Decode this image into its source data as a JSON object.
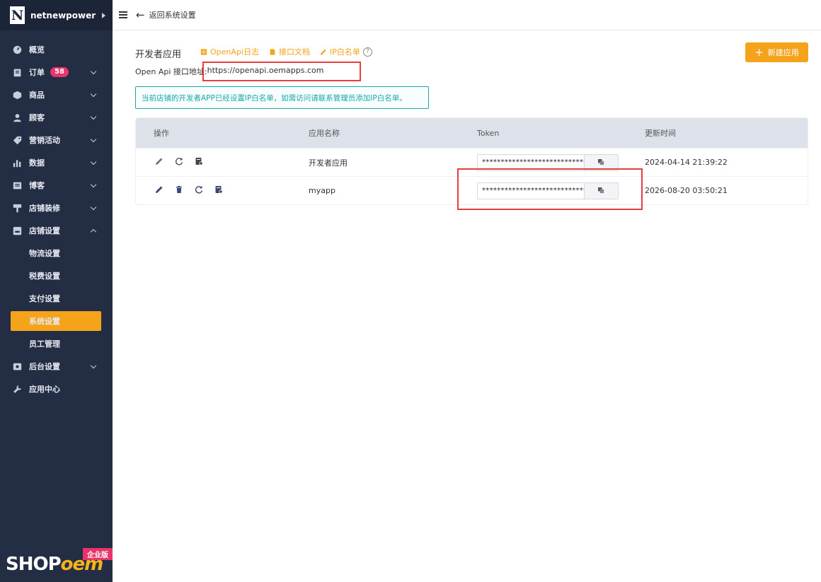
{
  "brand": {
    "logo_letter": "N",
    "name": "netnewpower"
  },
  "sidebar": {
    "items": [
      {
        "label": "概览",
        "icon": "dashboard-icon"
      },
      {
        "label": "订单",
        "icon": "order-icon",
        "badge": "58"
      },
      {
        "label": "商品",
        "icon": "product-icon"
      },
      {
        "label": "顾客",
        "icon": "customer-icon"
      },
      {
        "label": "营销活动",
        "icon": "tag-icon"
      },
      {
        "label": "数据",
        "icon": "chart-icon"
      },
      {
        "label": "博客",
        "icon": "blog-icon"
      },
      {
        "label": "店铺装修",
        "icon": "brush-icon"
      },
      {
        "label": "店铺设置",
        "icon": "store-settings-icon"
      }
    ],
    "sub_items": [
      "物流设置",
      "税费设置",
      "支付设置",
      "系统设置",
      "员工管理"
    ],
    "items_after": [
      {
        "label": "后台设置",
        "icon": "admin-settings-icon"
      },
      {
        "label": "应用中心",
        "icon": "wrench-icon"
      }
    ],
    "footer_logo": {
      "shop": "SHOP",
      "oem": "oem",
      "edition": "企业版"
    }
  },
  "topbar": {
    "back_label": "返回系统设置"
  },
  "main": {
    "title": "开发者应用",
    "links": [
      "OpenApi日志",
      "接口文档",
      "IP白名单"
    ],
    "new_button": "新建应用",
    "api_label": "Open Api 接口地址:",
    "api_url": "https://openapi.oemapps.com",
    "notice": "当前店铺的开发者APP已经设置IP白名单，如需访问请联系管理员添加IP白名单。",
    "table": {
      "headers": [
        "操作",
        "应用名称",
        "Token",
        "更新时间"
      ],
      "rows": [
        {
          "name": "开发者应用",
          "token": "****************************",
          "updated": "2024-04-14 21:39:22"
        },
        {
          "name": "myapp",
          "token": "****************************",
          "updated": "2026-08-20 03:50:21"
        }
      ]
    }
  },
  "colors": {
    "accent": "#f5a31a",
    "sidebar_bg": "#232d44",
    "badge": "#e8336b",
    "notice": "#1ba6a6",
    "highlight": "#e53e3e"
  }
}
